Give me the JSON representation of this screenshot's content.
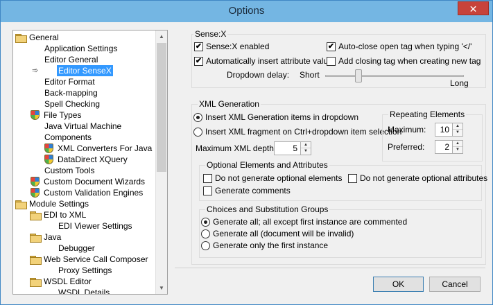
{
  "window": {
    "title": "Options",
    "close_glyph": "✕"
  },
  "tree": {
    "items": [
      {
        "label": "General",
        "icon": "folder-icon"
      },
      {
        "label": "Application Settings"
      },
      {
        "label": "Editor General"
      },
      {
        "label": "Editor SenseX",
        "selected": true
      },
      {
        "label": "Editor Format"
      },
      {
        "label": "Back-mapping"
      },
      {
        "label": "Spell Checking"
      },
      {
        "label": "File Types",
        "icon": "shield-icon"
      },
      {
        "label": "Java Virtual Machine"
      },
      {
        "label": "Components"
      },
      {
        "label": "XML Converters For Java",
        "icon": "shield-icon"
      },
      {
        "label": "DataDirect XQuery",
        "icon": "shield-icon"
      },
      {
        "label": "Custom Tools"
      },
      {
        "label": "Custom Document Wizards",
        "icon": "shield-icon"
      },
      {
        "label": "Custom Validation Engines",
        "icon": "shield-icon"
      },
      {
        "label": "Module Settings",
        "icon": "folder-icon"
      },
      {
        "label": "EDI to XML",
        "icon": "folder-icon"
      },
      {
        "label": "EDI Viewer Settings"
      },
      {
        "label": "Java",
        "icon": "folder-icon"
      },
      {
        "label": "Debugger"
      },
      {
        "label": "Web Service Call Composer",
        "icon": "folder-icon"
      },
      {
        "label": "Proxy Settings"
      },
      {
        "label": "WSDL Editor",
        "icon": "folder-icon"
      },
      {
        "label": "WSDL Details"
      }
    ],
    "selected_marker": "➾",
    "scroll_up": "▲",
    "scroll_down": "▼"
  },
  "sensex": {
    "title": "Sense:X",
    "enabled_label": "Sense:X enabled",
    "enabled_checked": true,
    "auto_insert_label": "Automatically insert attribute value",
    "auto_insert_checked": true,
    "auto_close_label": "Auto-close open tag when typing '</'",
    "auto_close_checked": true,
    "add_closing_label": "Add closing tag when creating new tag",
    "add_closing_checked": false,
    "delay_label": "Dropdown delay:",
    "short_label": "Short",
    "long_label": "Long",
    "delay_level": 0.25
  },
  "xml_generation": {
    "title": "XML Generation",
    "insert_items_label": "Insert XML Generation items in dropdown",
    "insert_fragment_label": "Insert XML fragment on Ctrl+dropdown item selection",
    "selected_option": "insert_items",
    "max_depth_label": "Maximum XML depth:",
    "max_depth_value": "5",
    "repeating": {
      "title": "Repeating Elements",
      "maximum_label": "Maximum:",
      "maximum_value": "10",
      "preferred_label": "Preferred:",
      "preferred_value": "2"
    },
    "optional": {
      "title": "Optional Elements and Attributes",
      "no_elements_label": "Do not generate optional elements",
      "no_attributes_label": "Do not generate optional attributes",
      "comments_label": "Generate comments"
    },
    "choices": {
      "title": "Choices and Substitution Groups",
      "opt1_label": "Generate all; all except first instance are commented",
      "opt2_label": "Generate all (document will be invalid)",
      "opt3_label": "Generate only the first instance",
      "selected": "opt1"
    }
  },
  "spin_glyphs": {
    "up": "▲",
    "down": "▼"
  },
  "check_glyph": "✔",
  "buttons": {
    "ok": "OK",
    "cancel": "Cancel"
  }
}
